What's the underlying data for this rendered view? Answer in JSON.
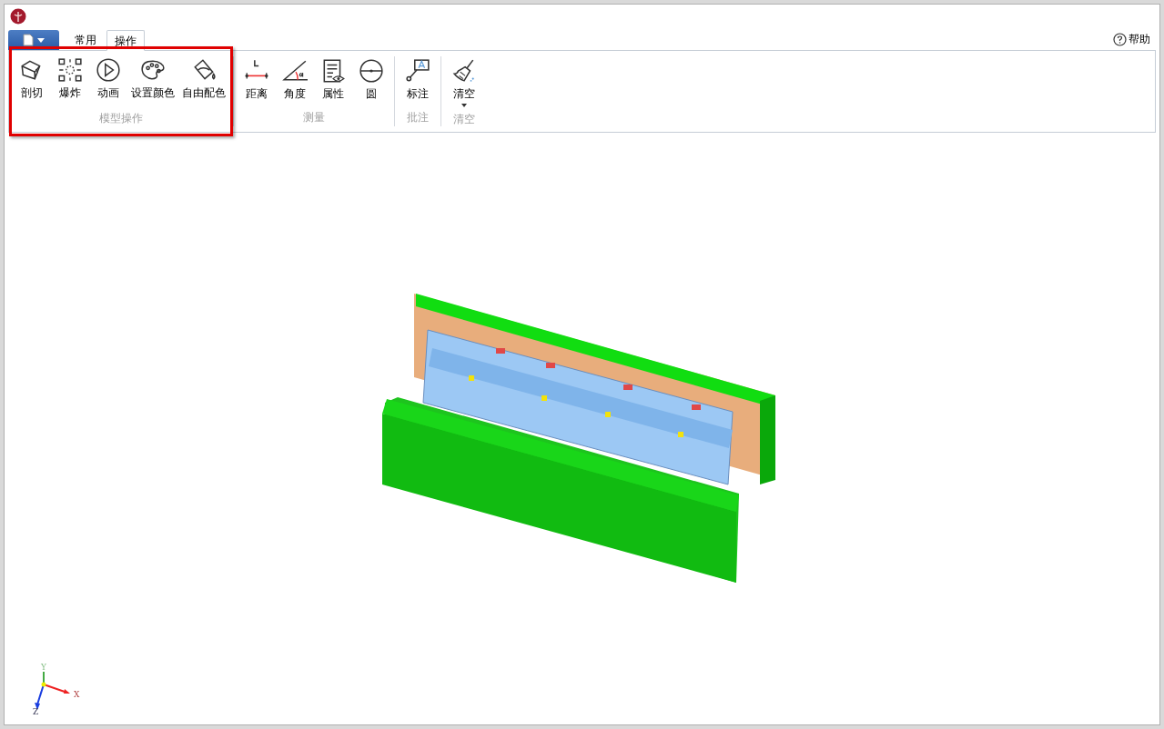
{
  "tabs": [
    {
      "label": "常用",
      "selected": false
    },
    {
      "label": "操作",
      "selected": true
    }
  ],
  "help": {
    "label": "帮助"
  },
  "ribbon": {
    "groups": [
      {
        "label": "模型操作",
        "highlighted": true,
        "buttons": [
          {
            "label": "剖切",
            "dropdown": false
          },
          {
            "label": "爆炸",
            "dropdown": false
          },
          {
            "label": "动画",
            "dropdown": false
          },
          {
            "label": "设置颜色",
            "dropdown": false
          },
          {
            "label": "自由配色",
            "dropdown": false
          }
        ]
      },
      {
        "label": "测量",
        "highlighted": false,
        "buttons": [
          {
            "label": "距离",
            "dropdown": false
          },
          {
            "label": "角度",
            "dropdown": false
          },
          {
            "label": "属性",
            "dropdown": false
          },
          {
            "label": "圆",
            "dropdown": false
          }
        ]
      },
      {
        "label": "批注",
        "highlighted": false,
        "buttons": [
          {
            "label": "标注",
            "dropdown": false
          }
        ]
      },
      {
        "label": "清空",
        "highlighted": false,
        "buttons": [
          {
            "label": "清空",
            "dropdown": true
          }
        ]
      }
    ]
  },
  "axes": [
    {
      "label": "Y"
    },
    {
      "label": "X"
    },
    {
      "label": "Z"
    }
  ]
}
